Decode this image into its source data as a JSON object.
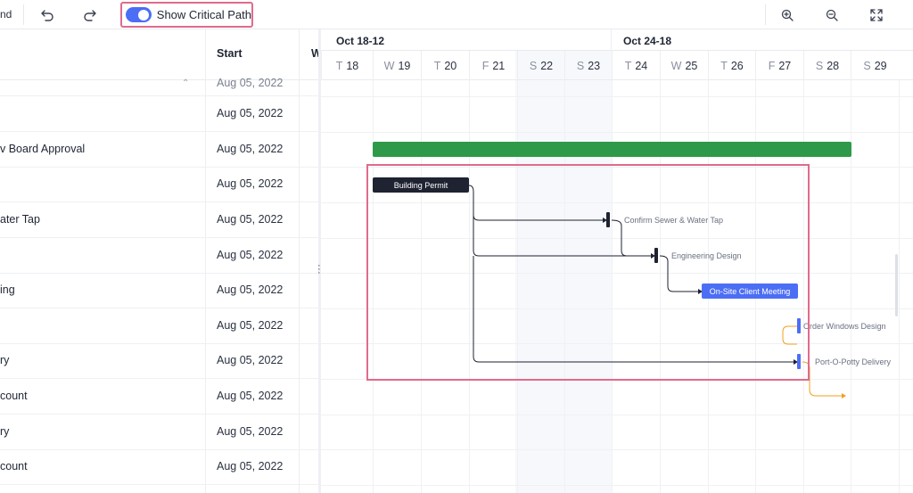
{
  "toolbar": {
    "cut_label": "nd",
    "undo_icon": "undo-icon",
    "redo_icon": "redo-icon",
    "critical_path_label": "Show Critical Path",
    "critical_path_on": true,
    "zoom_in_icon": "zoom-in-icon",
    "zoom_out_icon": "zoom-out-icon",
    "fullscreen_icon": "fullscreen-icon"
  },
  "grid": {
    "columns": [
      "Start",
      "W"
    ],
    "rows": [
      {
        "name": "",
        "start": "Aug 05, 2022"
      },
      {
        "name": "",
        "start": "Aug 05, 2022"
      },
      {
        "name": "v Board Approval",
        "start": "Aug 05, 2022"
      },
      {
        "name": "",
        "start": "Aug 05, 2022"
      },
      {
        "name": "ater Tap",
        "start": "Aug 05, 2022"
      },
      {
        "name": "",
        "start": "Aug 05, 2022"
      },
      {
        "name": "ing",
        "start": "Aug 05, 2022"
      },
      {
        "name": "",
        "start": "Aug 05, 2022"
      },
      {
        "name": "ry",
        "start": "Aug 05, 2022"
      },
      {
        "name": "count",
        "start": "Aug 05, 2022"
      },
      {
        "name": "ry",
        "start": "Aug 05, 2022"
      },
      {
        "name": "count",
        "start": "Aug 05, 2022"
      }
    ]
  },
  "timeline": {
    "weeks": [
      "Oct 18-12",
      "Oct 24-18"
    ],
    "days": [
      {
        "letter": "T",
        "num": "18"
      },
      {
        "letter": "W",
        "num": "19"
      },
      {
        "letter": "T",
        "num": "20"
      },
      {
        "letter": "F",
        "num": "21"
      },
      {
        "letter": "S",
        "num": "22"
      },
      {
        "letter": "S",
        "num": "23"
      },
      {
        "letter": "T",
        "num": "24"
      },
      {
        "letter": "W",
        "num": "25"
      },
      {
        "letter": "T",
        "num": "26"
      },
      {
        "letter": "F",
        "num": "27"
      },
      {
        "letter": "S",
        "num": "28"
      },
      {
        "letter": "S",
        "num": "29"
      }
    ],
    "tasks": {
      "building_permit": "Building Permit",
      "confirm_sewer": "Confirm Sewer & Water Tap",
      "engineering_design": "Engineering Design",
      "onsite_meeting": "On-Site Client Meeting",
      "order_windows": "Order Windows Design",
      "port_o_potty": "Port-O-Potty Delivery"
    }
  },
  "colors": {
    "accent": "#4c6ef5",
    "summary_bar": "#2e9a49",
    "critical_highlight": "#e06b8b",
    "link_dark": "#1e2231",
    "link_orange": "#f0a020"
  }
}
